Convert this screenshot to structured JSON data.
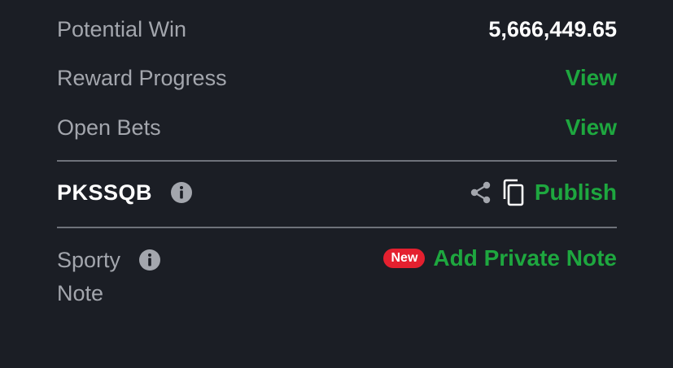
{
  "potential_win": {
    "label": "Potential Win",
    "value": "5,666,449.65"
  },
  "reward_progress": {
    "label": "Reward Progress",
    "action": "View"
  },
  "open_bets": {
    "label": "Open Bets",
    "action": "View"
  },
  "booking": {
    "code": "PKSSQB",
    "info_icon": "info-icon",
    "share_icon": "share-icon",
    "copy_icon": "copy-icon",
    "publish_label": "Publish"
  },
  "note": {
    "label_line1": "Sporty",
    "label_line2": "Note",
    "badge": "New",
    "action": "Add Private Note"
  },
  "colors": {
    "background": "#1b1e25",
    "accent_green": "#1ea73f",
    "badge_red": "#e4202f",
    "label_gray": "#a3a6ad"
  }
}
